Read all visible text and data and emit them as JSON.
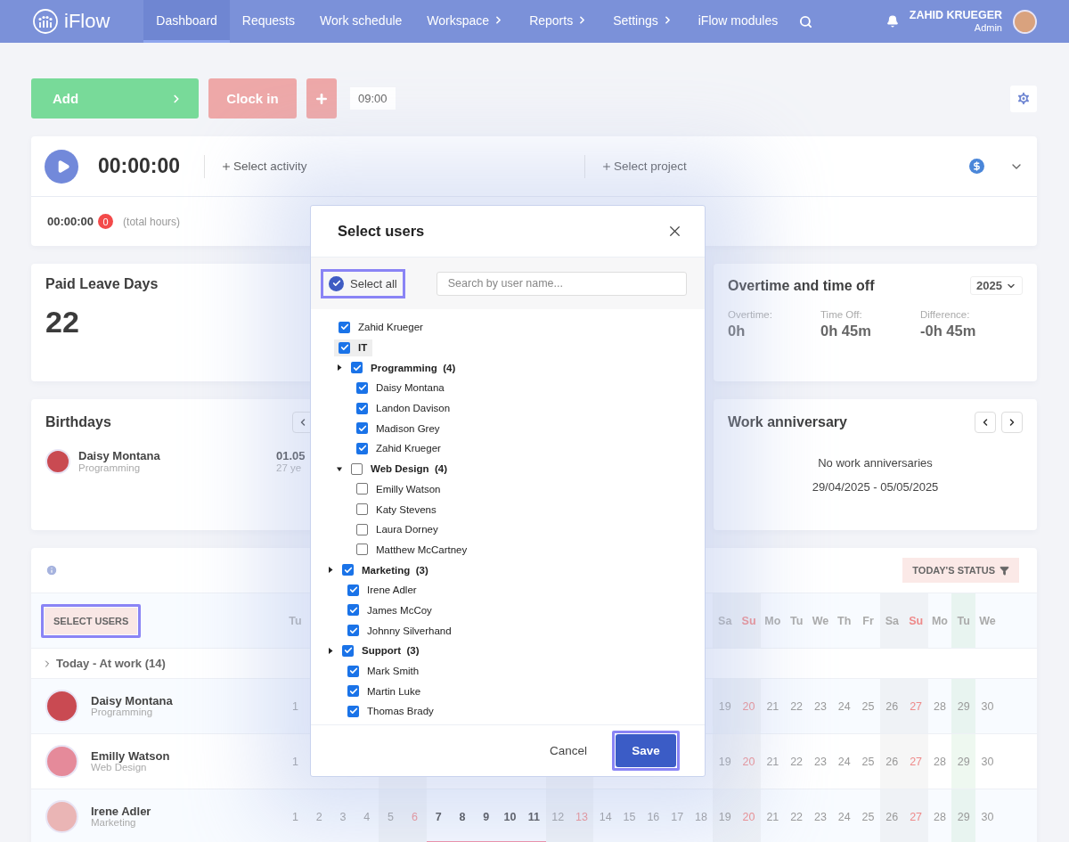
{
  "nav": {
    "logo": "iFlow",
    "items": [
      {
        "label": "Dashboard",
        "selected": true,
        "has_submenu": false
      },
      {
        "label": "Requests",
        "selected": false,
        "has_submenu": false
      },
      {
        "label": "Work schedule",
        "selected": false,
        "has_submenu": false
      },
      {
        "label": "Workspace",
        "selected": false,
        "has_submenu": true
      },
      {
        "label": "Reports",
        "selected": false,
        "has_submenu": true
      },
      {
        "label": "Settings",
        "selected": false,
        "has_submenu": true
      },
      {
        "label": "iFlow modules",
        "selected": false,
        "has_submenu": false
      }
    ],
    "user": {
      "name": "ZAHID KRUEGER",
      "role": "Admin"
    }
  },
  "actions": {
    "add": "Add",
    "clock_in": "Clock in",
    "time": "09:00"
  },
  "timer": {
    "time": "00:00:00",
    "activity": "Select activity",
    "project": "Select project",
    "total": "00:00:00",
    "badge": "0",
    "total_label": "(total hours)"
  },
  "paid_leave": {
    "title": "Paid Leave Days",
    "value": "22"
  },
  "overtime": {
    "title": "Overtime and time off",
    "year": "2025",
    "stats": [
      {
        "label": "Overtime:",
        "value": "0h"
      },
      {
        "label": "Time Off:",
        "value": "0h 45m"
      },
      {
        "label": "Difference:",
        "value": "-0h 45m"
      }
    ]
  },
  "birthdays": {
    "title": "Birthdays",
    "people": [
      {
        "name": "Daisy Montana",
        "team": "Programming",
        "date": "01.05",
        "age": "27 ye"
      }
    ]
  },
  "work_anniversary": {
    "title": "Work anniversary",
    "empty": "No work anniversaries",
    "range": "29/04/2025 - 05/05/2025"
  },
  "calendar": {
    "status_button": "TODAY'S STATUS",
    "select_users": {
      "label": "SELECT USERS",
      "highlighted": true
    },
    "group": {
      "label": "Today - At work (14)",
      "expanded": false
    },
    "columns": [
      {
        "kind": "weekday",
        "label": "Tu"
      },
      {
        "kind": "weekday"
      },
      {
        "kind": "weekday"
      },
      {
        "kind": "weekday"
      },
      {
        "kind": "saturday"
      },
      {
        "kind": "sunday"
      },
      {
        "kind": "weekday"
      },
      {
        "kind": "weekday"
      },
      {
        "kind": "weekday"
      },
      {
        "kind": "weekday"
      },
      {
        "kind": "weekday"
      },
      {
        "kind": "saturday"
      },
      {
        "kind": "sunday"
      },
      {
        "kind": "weekday"
      },
      {
        "kind": "weekday"
      },
      {
        "kind": "weekday"
      },
      {
        "kind": "weekday"
      },
      {
        "kind": "weekday"
      },
      {
        "kind": "saturday",
        "label": "Sa"
      },
      {
        "kind": "sunday",
        "label": "Su"
      },
      {
        "kind": "weekday",
        "label": "Mo"
      },
      {
        "kind": "weekday",
        "label": "Tu"
      },
      {
        "kind": "weekday",
        "label": "We"
      },
      {
        "kind": "weekday",
        "label": "Th"
      },
      {
        "kind": "weekday",
        "label": "Fr"
      },
      {
        "kind": "saturday",
        "label": "Sa"
      },
      {
        "kind": "sunday",
        "label": "Su"
      },
      {
        "kind": "weekday",
        "label": "Mo"
      },
      {
        "kind": "today",
        "label": "Tu"
      },
      {
        "kind": "weekday",
        "label": "We"
      }
    ],
    "rows": [
      {
        "name": "Daisy Montana",
        "team": "Programming",
        "days_left": [
          {
            "d": "1",
            "marked": false
          }
        ],
        "days_right": [
          {
            "d": "19",
            "marked": false
          },
          {
            "d": "20",
            "marked": false
          },
          {
            "d": "21",
            "marked": false
          },
          {
            "d": "22",
            "marked": false
          },
          {
            "d": "23",
            "marked": false
          },
          {
            "d": "24",
            "marked": false
          },
          {
            "d": "25",
            "marked": false
          },
          {
            "d": "26",
            "marked": false
          },
          {
            "d": "27",
            "marked": false
          },
          {
            "d": "28",
            "marked": false
          },
          {
            "d": "29",
            "marked": false
          },
          {
            "d": "30",
            "marked": false
          }
        ]
      },
      {
        "name": "Emilly Watson",
        "team": "Web Design",
        "days_left": [
          {
            "d": "1",
            "marked": false
          }
        ],
        "days_right": [
          {
            "d": "19",
            "marked": false
          },
          {
            "d": "20",
            "marked": false
          },
          {
            "d": "21",
            "marked": false
          },
          {
            "d": "22",
            "marked": false
          },
          {
            "d": "23",
            "marked": false
          },
          {
            "d": "24",
            "marked": false
          },
          {
            "d": "25",
            "marked": false
          },
          {
            "d": "26",
            "marked": false
          },
          {
            "d": "27",
            "marked": false
          },
          {
            "d": "28",
            "marked": false
          },
          {
            "d": "29",
            "marked": false
          },
          {
            "d": "30",
            "marked": false
          }
        ]
      },
      {
        "name": "Irene Adler",
        "team": "Marketing",
        "days": [
          {
            "d": "1",
            "marked": false
          },
          {
            "d": "2",
            "marked": false
          },
          {
            "d": "3",
            "marked": false
          },
          {
            "d": "4",
            "marked": false
          },
          {
            "d": "5",
            "marked": false
          },
          {
            "d": "6",
            "marked": false
          },
          {
            "d": "7",
            "marked": true
          },
          {
            "d": "8",
            "marked": true
          },
          {
            "d": "9",
            "marked": true
          },
          {
            "d": "10",
            "marked": true
          },
          {
            "d": "11",
            "marked": true
          },
          {
            "d": "12",
            "marked": false
          },
          {
            "d": "13",
            "marked": false
          },
          {
            "d": "14",
            "marked": false
          },
          {
            "d": "15",
            "marked": false
          },
          {
            "d": "16",
            "marked": false
          },
          {
            "d": "17",
            "marked": false
          },
          {
            "d": "18",
            "marked": false
          },
          {
            "d": "19",
            "marked": false
          },
          {
            "d": "20",
            "marked": false
          },
          {
            "d": "21",
            "marked": false
          },
          {
            "d": "22",
            "marked": false
          },
          {
            "d": "23",
            "marked": false
          },
          {
            "d": "24",
            "marked": false
          },
          {
            "d": "25",
            "marked": false
          },
          {
            "d": "26",
            "marked": false
          },
          {
            "d": "27",
            "marked": false
          },
          {
            "d": "28",
            "marked": false
          },
          {
            "d": "29",
            "marked": false
          },
          {
            "d": "30",
            "marked": false
          }
        ]
      }
    ]
  },
  "dialog": {
    "title": "Select users",
    "select_all": {
      "label": "Select all",
      "checked": true,
      "highlighted": true
    },
    "search": {
      "placeholder": "Search by user name..."
    },
    "tree": [
      {
        "kind": "user",
        "name": "Zahid Krueger",
        "checked": true
      },
      {
        "kind": "department",
        "name": "IT",
        "checked": true,
        "children": [
          {
            "kind": "group",
            "name": "Programming",
            "count": "(4)",
            "checked": true,
            "expanded": false,
            "children": [
              {
                "kind": "user",
                "name": "Daisy Montana",
                "checked": true
              },
              {
                "kind": "user",
                "name": "Landon Davison",
                "checked": true
              },
              {
                "kind": "user",
                "name": "Madison Grey",
                "checked": true
              },
              {
                "kind": "user",
                "name": "Zahid Krueger",
                "checked": true
              }
            ]
          },
          {
            "kind": "group",
            "name": "Web Design",
            "count": "(4)",
            "checked": false,
            "expanded": true,
            "children": [
              {
                "kind": "user",
                "name": "Emilly Watson",
                "checked": false
              },
              {
                "kind": "user",
                "name": "Katy Stevens",
                "checked": false
              },
              {
                "kind": "user",
                "name": "Laura Dorney",
                "checked": false
              },
              {
                "kind": "user",
                "name": "Matthew McCartney",
                "checked": false
              }
            ]
          }
        ]
      },
      {
        "kind": "group",
        "name": "Marketing",
        "count": "(3)",
        "checked": true,
        "expanded": false,
        "children": [
          {
            "kind": "user",
            "name": "Irene Adler",
            "checked": true
          },
          {
            "kind": "user",
            "name": "James McCoy",
            "checked": true
          },
          {
            "kind": "user",
            "name": "Johnny Silverhand",
            "checked": true
          }
        ]
      },
      {
        "kind": "group",
        "name": "Support",
        "count": "(3)",
        "checked": true,
        "expanded": false,
        "children": [
          {
            "kind": "user",
            "name": "Mark Smith",
            "checked": true
          },
          {
            "kind": "user",
            "name": "Martin Luke",
            "checked": true
          },
          {
            "kind": "user",
            "name": "Thomas Brady",
            "checked": true
          }
        ]
      }
    ],
    "cancel": "Cancel",
    "save": {
      "label": "Save",
      "highlighted": true
    }
  }
}
